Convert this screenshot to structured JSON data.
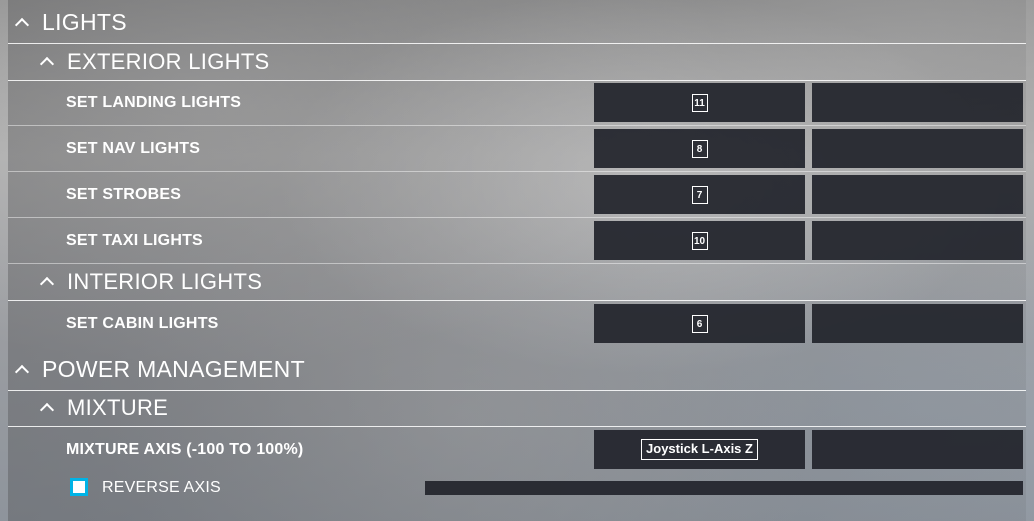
{
  "sections": {
    "lights": {
      "title": "LIGHTS",
      "exterior": {
        "title": "EXTERIOR LIGHTS",
        "rows": [
          {
            "label": "SET LANDING LIGHTS",
            "primary_binding": "11",
            "secondary_binding": ""
          },
          {
            "label": "SET NAV LIGHTS",
            "primary_binding": "8",
            "secondary_binding": ""
          },
          {
            "label": "SET STROBES",
            "primary_binding": "7",
            "secondary_binding": ""
          },
          {
            "label": "SET TAXI LIGHTS",
            "primary_binding": "10",
            "secondary_binding": ""
          }
        ]
      },
      "interior": {
        "title": "INTERIOR LIGHTS",
        "rows": [
          {
            "label": "SET CABIN LIGHTS",
            "primary_binding": "6",
            "secondary_binding": ""
          }
        ]
      }
    },
    "power_management": {
      "title": "POWER MANAGEMENT",
      "mixture": {
        "title": "MIXTURE",
        "rows": [
          {
            "label": "MIXTURE AXIS (-100 TO 100%)",
            "primary_binding": "Joystick L-Axis Z",
            "secondary_binding": ""
          }
        ],
        "reverse_axis": {
          "label": "REVERSE AXIS",
          "checked": false
        }
      }
    }
  },
  "colors": {
    "slot_background": "#22252c",
    "checkbox_accent": "#00b3e6",
    "text": "#ffffff"
  },
  "icons": {
    "collapse": "chevron-up-icon"
  }
}
